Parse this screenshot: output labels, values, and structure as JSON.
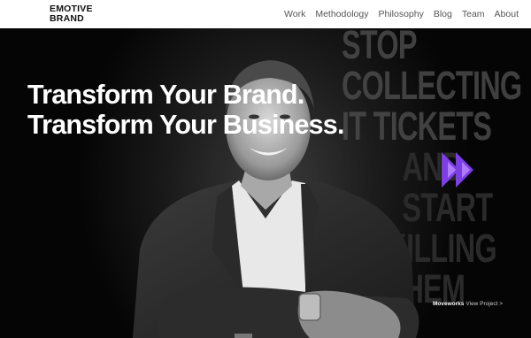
{
  "brand": {
    "logo_line1": "EMOTIVE",
    "logo_line2": "BRAND"
  },
  "nav": {
    "items": [
      {
        "label": "Work"
      },
      {
        "label": "Methodology"
      },
      {
        "label": "Philosophy"
      },
      {
        "label": "Blog"
      },
      {
        "label": "Team"
      },
      {
        "label": "About"
      }
    ]
  },
  "hero": {
    "headline_line1": "Transform Your Brand.",
    "headline_line2": "Transform Your Business.",
    "background_words": [
      "STOP",
      "COLLECTING",
      "IT TICKETS",
      "AND",
      "START",
      "KILLING",
      "THEM"
    ],
    "accent_color": "#7b3fe4",
    "project": {
      "name": "Moveworks",
      "cta": "View Project >"
    }
  }
}
